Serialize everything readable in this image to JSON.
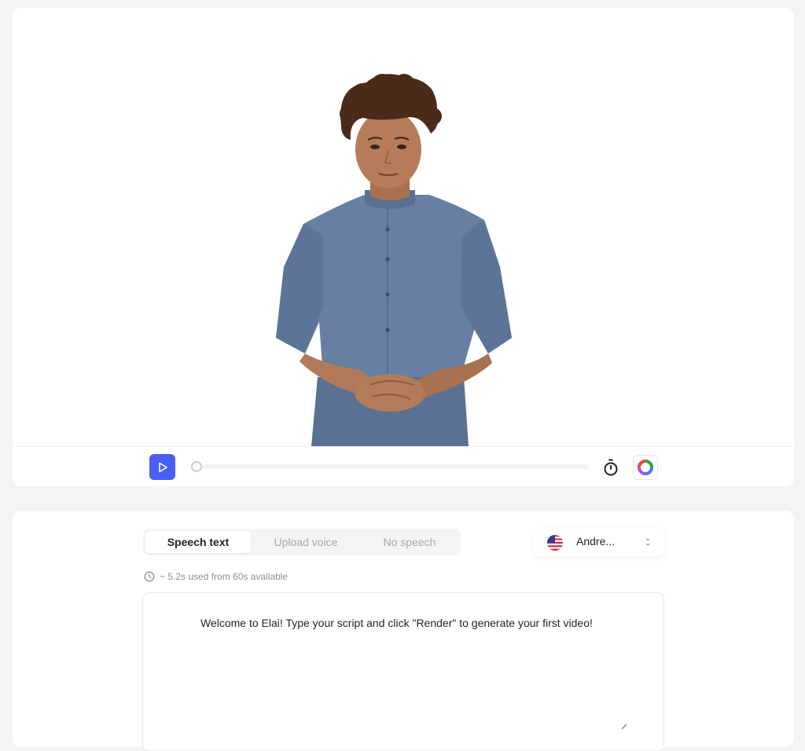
{
  "player": {
    "progress": 0,
    "accent_color": "#4a5ff2",
    "icons": {
      "play": "play-icon",
      "timer": "stopwatch-icon",
      "color": "color-ring-icon"
    }
  },
  "script": {
    "tabs": [
      {
        "label": "Speech text",
        "active": true
      },
      {
        "label": "Upload voice",
        "active": false
      },
      {
        "label": "No speech",
        "active": false
      }
    ],
    "voice": {
      "name": "Andre...",
      "flag": "us-flag-icon"
    },
    "usage": "~ 5.2s used from 60s available",
    "text": "Welcome to Elai! Type your script and click \"Render\" to generate your first video!"
  }
}
